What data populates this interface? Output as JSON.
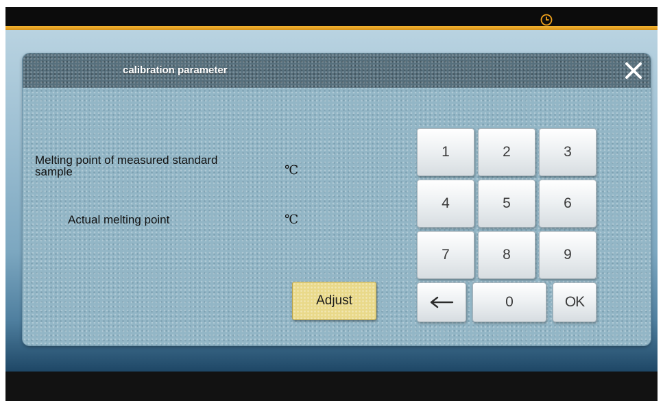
{
  "dialog": {
    "title": "calibration parameter"
  },
  "fields": {
    "measured_label": "Melting point of measured standard sample",
    "measured_unit": "℃",
    "actual_label": "Actual melting point",
    "actual_unit": "℃"
  },
  "adjust_button": {
    "label": "Adjust"
  },
  "keypad": {
    "keys": [
      "1",
      "2",
      "3",
      "4",
      "5",
      "6",
      "7",
      "8",
      "9",
      "←",
      "0",
      "OK"
    ]
  },
  "icons": {
    "clock": "clock-icon",
    "close": "close-icon",
    "backspace": "backspace-arrow"
  },
  "colors": {
    "accent_bar": "#f3b431",
    "dialog_body": "#93b6c6",
    "dialog_header": "#57707d",
    "adjust_button": "#e9d98a"
  }
}
